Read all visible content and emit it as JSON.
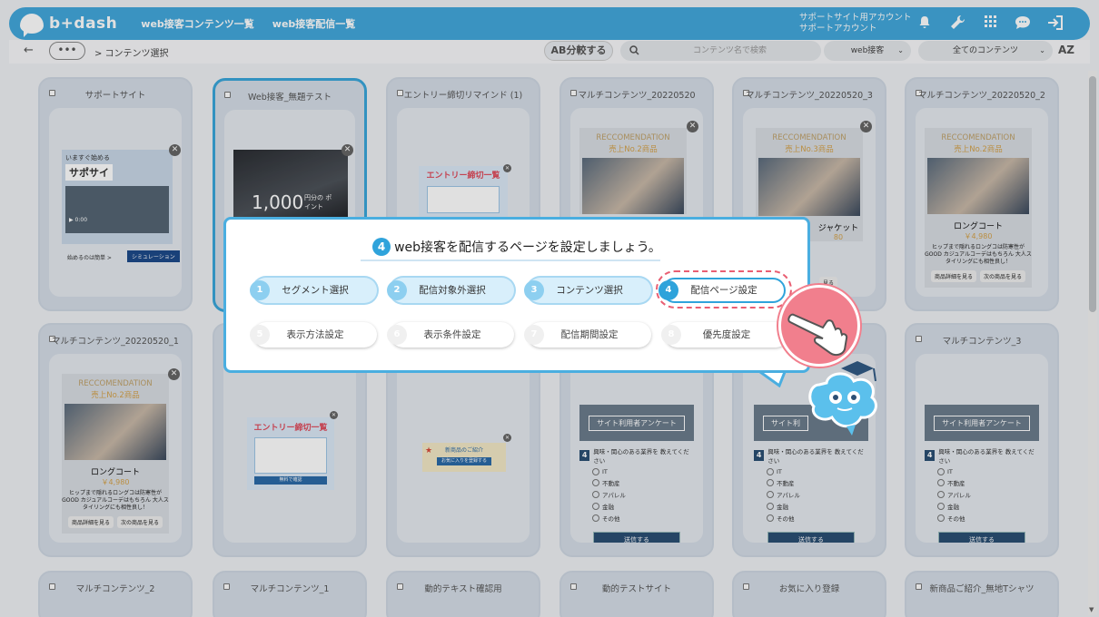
{
  "app": {
    "logo_text": "b+dash",
    "nav": [
      "web接客コンテンツ一覧",
      "web接客配信一覧"
    ],
    "account_line1": "サポートサイト用アカウント",
    "account_line2": "サポートアカウント",
    "icons": [
      "bell-icon",
      "wrench-icon",
      "grid-icon",
      "chat-icon",
      "logout-icon"
    ]
  },
  "subbar": {
    "breadcrumb": "> コンテンツ選択",
    "more": "•••",
    "ab_button": "AB分較する",
    "search_placeholder": "コンテンツ名で検索",
    "filter1": "web接客",
    "filter2": "全てのコンテンツ",
    "sort": "AZ"
  },
  "cards": [
    {
      "title": "サポートサイト"
    },
    {
      "title": "Web接客_無題テスト"
    },
    {
      "title": "エントリー締切リマインド (1)"
    },
    {
      "title": "マルチコンテンツ_20220520"
    },
    {
      "title": "マルチコンテンツ_20220520_3"
    },
    {
      "title": "マルチコンテンツ_20220520_2"
    },
    {
      "title": "マルチコンテンツ_20220520_1"
    },
    {
      "title": ""
    },
    {
      "title": ""
    },
    {
      "title": ""
    },
    {
      "title": ""
    },
    {
      "title": "マルチコンテンツ_3"
    },
    {
      "title": "マルチコンテンツ_2"
    },
    {
      "title": "マルチコンテンツ_1"
    },
    {
      "title": "動的テキスト確認用"
    },
    {
      "title": "動的テストサイト"
    },
    {
      "title": "お気に入り登録"
    },
    {
      "title": "新商品ご紹介_無地Tシャツ"
    }
  ],
  "card_content": {
    "support": {
      "line1": "いますぐ始める",
      "line2": "サポサイ",
      "time": "0:00",
      "foot": "始めるのは簡単 >",
      "btn": "シミュレーション"
    },
    "web": {
      "big": "1,000",
      "small": "円分の ポイント"
    },
    "entry": {
      "title": "エントリー締切一覧",
      "btn": "無料で確認"
    },
    "product": {
      "rec": "RECCOMENDATION",
      "rank2": "売上No.2商品",
      "rank3": "売上No.3商品",
      "name": "ロングコート",
      "name_jacket": "ジャケット",
      "price": "￥4,980",
      "price_partial": "80",
      "desc": "ヒップまで隠れるロングコは防寒性がGOOD カジュアルコーデはもちろん 大人スタイリングにも相性良し！",
      "btn1": "商品詳細を見る",
      "btn2": "次の商品を見る"
    },
    "survey": {
      "head": "サイト利用者アンケート",
      "head_partial": "サイト利",
      "qnum": "4",
      "question": "興味・関心のある業界を 教えてください",
      "options": [
        "IT",
        "不動産",
        "アパレル",
        "金融",
        "その他"
      ],
      "send": "送信する"
    },
    "dynamic_text": {
      "line": "新商品のご紹介",
      "btn": "お気に入りを登録する"
    }
  },
  "modal": {
    "step_num": "4",
    "title": "web接客を配信するページを設定しましょう。",
    "steps": [
      {
        "n": "1",
        "label": "セグメント選択",
        "state": "done"
      },
      {
        "n": "2",
        "label": "配信対象外選択",
        "state": "done"
      },
      {
        "n": "3",
        "label": "コンテンツ選択",
        "state": "done"
      },
      {
        "n": "4",
        "label": "配信ページ設定",
        "state": "active"
      },
      {
        "n": "5",
        "label": "表示方法設定",
        "state": "todo"
      },
      {
        "n": "6",
        "label": "表示条件設定",
        "state": "todo"
      },
      {
        "n": "7",
        "label": "配信期間設定",
        "state": "todo"
      },
      {
        "n": "8",
        "label": "優先度設定",
        "state": "todo"
      }
    ]
  },
  "colors": {
    "accent": "#43a8dc",
    "highlight": "#e95e72",
    "pointer": "#f17f8d",
    "survey_button": "#2b4f74"
  }
}
